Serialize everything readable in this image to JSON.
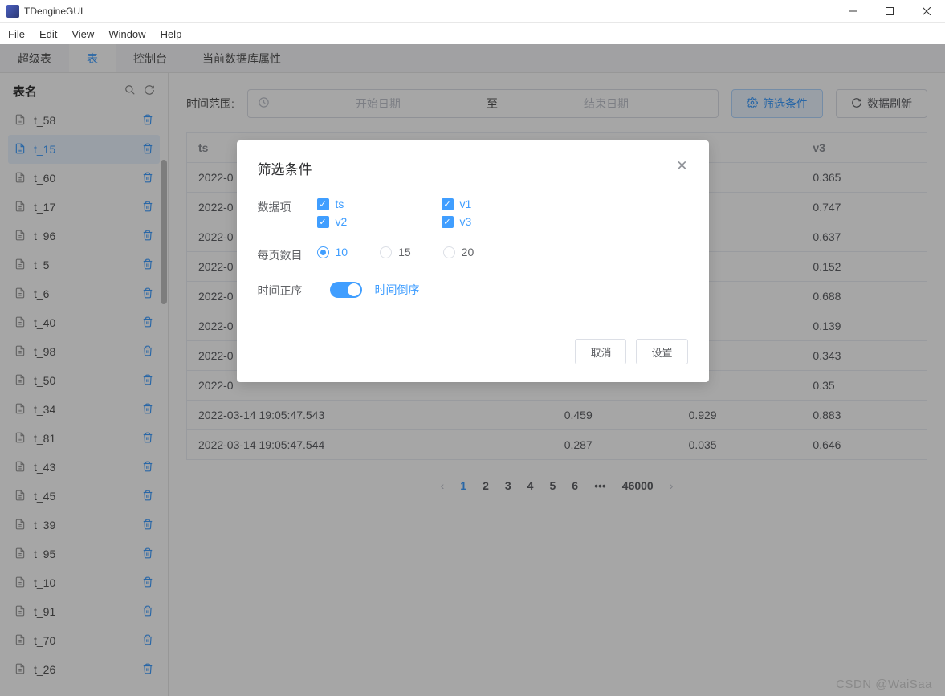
{
  "window": {
    "title": "TDengineGUI"
  },
  "menu": [
    "File",
    "Edit",
    "View",
    "Window",
    "Help"
  ],
  "tabs": [
    "超级表",
    "表",
    "控制台",
    "当前数据库属性"
  ],
  "active_tab": 1,
  "sidebar": {
    "title": "表名",
    "items": [
      "t_58",
      "t_15",
      "t_60",
      "t_17",
      "t_96",
      "t_5",
      "t_6",
      "t_40",
      "t_98",
      "t_50",
      "t_34",
      "t_81",
      "t_43",
      "t_45",
      "t_39",
      "t_95",
      "t_10",
      "t_91",
      "t_70",
      "t_26"
    ],
    "selected": 1
  },
  "toolbar": {
    "range_label": "时间范围:",
    "start_ph": "开始日期",
    "sep": "至",
    "end_ph": "结束日期",
    "filter_btn": "筛选条件",
    "refresh_btn": "数据刷新"
  },
  "table": {
    "headers": [
      "ts",
      "",
      "",
      "v3"
    ],
    "rows": [
      [
        "2022-0",
        "",
        "",
        "0.365"
      ],
      [
        "2022-0",
        "",
        "",
        "0.747"
      ],
      [
        "2022-0",
        "",
        "",
        "0.637"
      ],
      [
        "2022-0",
        "",
        "",
        "0.152"
      ],
      [
        "2022-0",
        "",
        "",
        "0.688"
      ],
      [
        "2022-0",
        "",
        "",
        "0.139"
      ],
      [
        "2022-0",
        "",
        "",
        "0.343"
      ],
      [
        "2022-0",
        "",
        "",
        "0.35"
      ],
      [
        "2022-03-14 19:05:47.543",
        "0.459",
        "0.929",
        "0.883"
      ],
      [
        "2022-03-14 19:05:47.544",
        "0.287",
        "0.035",
        "0.646"
      ]
    ]
  },
  "pager": {
    "pages": [
      "1",
      "2",
      "3",
      "4",
      "5",
      "6"
    ],
    "ellipsis": "•••",
    "last": "46000",
    "active": 0
  },
  "modal": {
    "title": "筛选条件",
    "data_label": "数据项",
    "checks": [
      "ts",
      "v1",
      "v2",
      "v3"
    ],
    "page_label": "每页数目",
    "radios": [
      "10",
      "15",
      "20"
    ],
    "radio_sel": 0,
    "order_left": "时间正序",
    "order_right": "时间倒序",
    "cancel": "取消",
    "ok": "设置"
  },
  "watermark": "CSDN @WaiSaa"
}
